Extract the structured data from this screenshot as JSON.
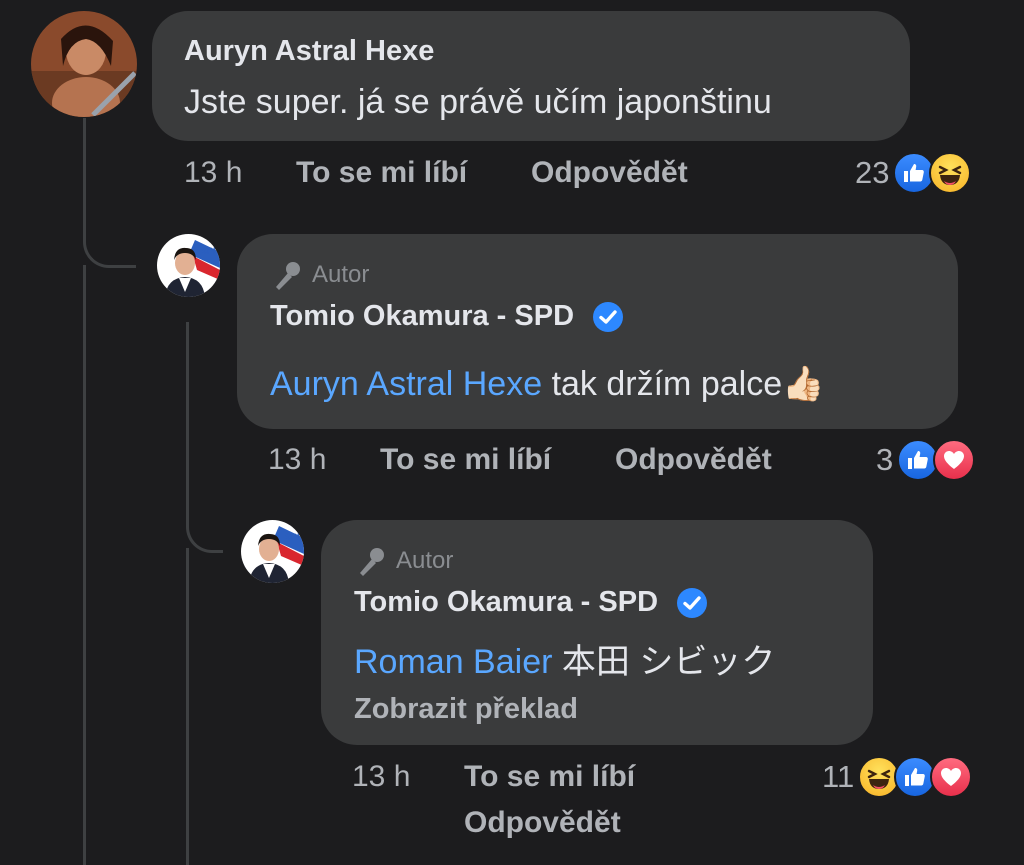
{
  "comments": [
    {
      "author": "Auryn Astral Hexe",
      "text": "Jste super. já se právě učím japonštinu",
      "time": "13 h",
      "like_label": "To se mi líbí",
      "reply_label": "Odpovědět",
      "reaction_count": "23",
      "reactions": [
        "like-icon",
        "haha-icon"
      ]
    },
    {
      "author_tag": "Autor",
      "author": "Tomio Okamura - SPD",
      "verified": true,
      "mention": "Auryn Astral Hexe",
      "text": " tak držím palce👍🏻",
      "time": "13 h",
      "like_label": "To se mi líbí",
      "reply_label": "Odpovědět",
      "reaction_count": "3",
      "reactions": [
        "like-icon",
        "love-icon"
      ]
    },
    {
      "author_tag": "Autor",
      "author": "Tomio Okamura - SPD",
      "verified": true,
      "mention": "Roman Baier",
      "text": " 本田 シビック",
      "see_translation": "Zobrazit překlad",
      "time": "13 h",
      "like_label": "To se mi líbí",
      "reply_label": "Odpovědět",
      "reaction_count": "11",
      "reactions": [
        "haha-icon",
        "like-icon",
        "love-icon"
      ]
    }
  ],
  "avatar_badge": "SPD",
  "colors": {
    "background": "#1c1c1e",
    "bubble": "#3a3b3c",
    "mention": "#5aa7ff",
    "like": "#1877f2",
    "love": "#f33e58",
    "verified": "#2d88ff"
  }
}
